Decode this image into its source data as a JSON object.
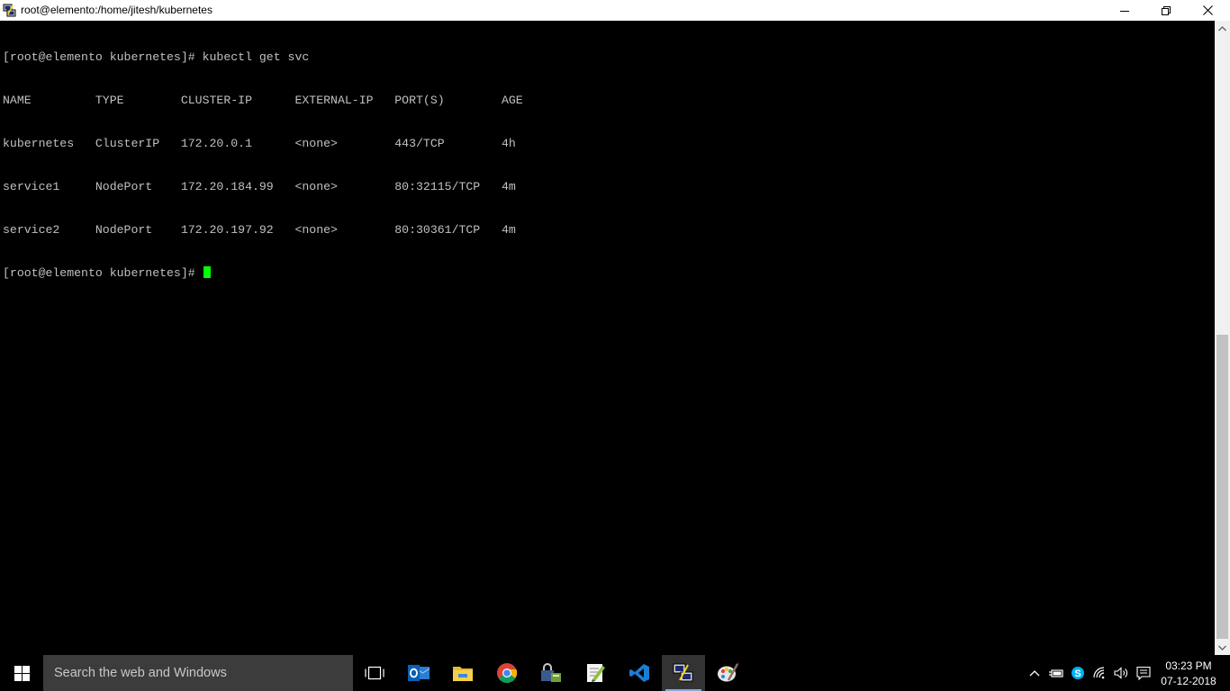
{
  "window": {
    "title": "root@elemento:/home/jitesh/kubernetes"
  },
  "terminal": {
    "lines": [
      "[root@elemento kubernetes]# kubectl get svc",
      "NAME         TYPE        CLUSTER-IP      EXTERNAL-IP   PORT(S)        AGE",
      "kubernetes   ClusterIP   172.20.0.1      <none>        443/TCP        4h",
      "service1     NodePort    172.20.184.99   <none>        80:32115/TCP   4m",
      "service2     NodePort    172.20.197.92   <none>        80:30361/TCP   4m",
      "[root@elemento kubernetes]# "
    ],
    "cursor_color": "#00ff00"
  },
  "taskbar": {
    "search_placeholder": "Search the web and Windows",
    "apps": [
      "task-view-icon",
      "outlook-icon",
      "file-explorer-icon",
      "chrome-icon",
      "security-app-icon",
      "notepad-plus-plus-icon",
      "vscode-icon",
      "putty-icon",
      "paint-icon"
    ],
    "tray": [
      "show-hidden-icons-icon",
      "battery-icon",
      "skype-icon",
      "wifi-icon",
      "volume-icon",
      "action-center-icon"
    ],
    "clock": {
      "time": "03:23 PM",
      "date": "07-12-2018"
    }
  },
  "colors": {
    "terminal_bg": "#000000",
    "terminal_fg": "#c0c0c0",
    "taskbar_bg": "#000000",
    "search_bg": "#3c3c3c"
  }
}
